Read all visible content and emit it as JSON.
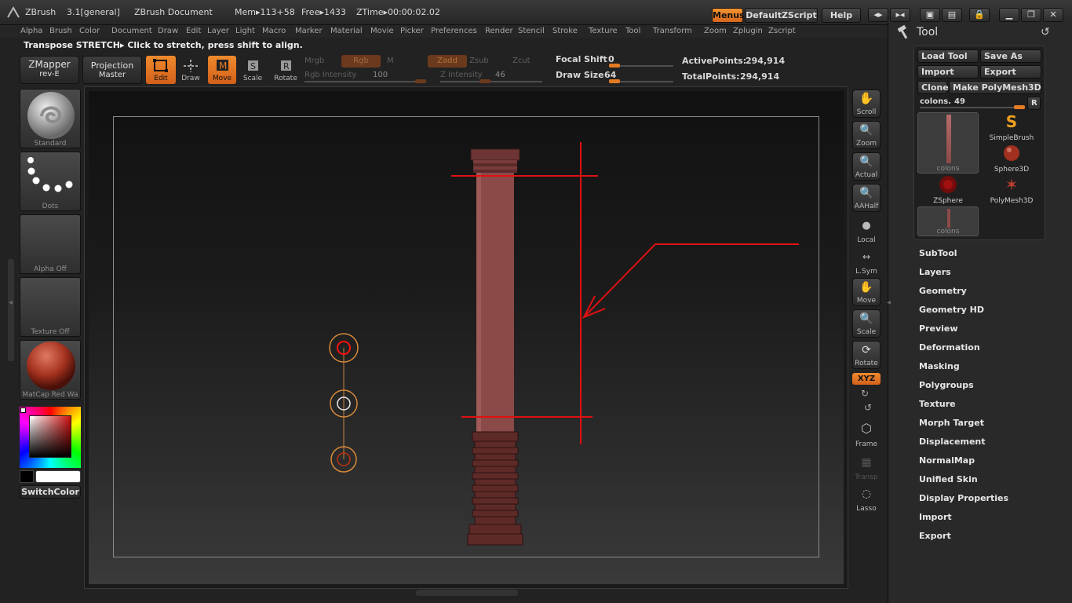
{
  "titlebar": {
    "app": "ZBrush",
    "version": "3.1[general]",
    "document": "ZBrush Document",
    "mem": "Mem▸113+58",
    "free": "Free▸1433",
    "ztime": "ZTime▸00:00:02.02",
    "menus_label": "Menus",
    "zscript_label": "DefaultZScript",
    "help_label": "Help"
  },
  "menu": [
    "Alpha",
    "Brush",
    "Color",
    "Document",
    "Draw",
    "Edit",
    "Layer",
    "Light",
    "Macro",
    "Marker",
    "Material",
    "Movie",
    "Picker",
    "Preferences",
    "Render",
    "Stencil",
    "Stroke",
    "Texture",
    "Tool",
    "Transform",
    "Zoom",
    "Zplugin",
    "Zscript"
  ],
  "status": "Transpose STRETCH▸ Click to stretch, press shift to align.",
  "shelf": {
    "zmapper": "ZMapper",
    "zmapper_sub": "rev-E",
    "projection": "Projection",
    "projection_sub": "Master",
    "edit": "Edit",
    "draw": "Draw",
    "move": "Move",
    "scale": "Scale",
    "rotate": "Rotate",
    "mrgb": "Mrgb",
    "rgb": "Rgb",
    "m": "M",
    "zadd": "Zadd",
    "zsub": "Zsub",
    "zcut": "Zcut",
    "rgb_intensity_label": "Rgb Intensity",
    "rgb_intensity": "100",
    "z_intensity_label": "Z Intensity",
    "z_intensity": "46",
    "focal_shift_label": "Focal Shift",
    "focal_shift": "0",
    "draw_size_label": "Draw Size",
    "draw_size": "64",
    "active_points_label": "ActivePoints:",
    "active_points": "294,914",
    "total_points_label": "TotalPoints:",
    "total_points": "294,914"
  },
  "left": {
    "brush": "Standard",
    "stroke": "Dots",
    "alpha": "Alpha Off",
    "texture": "Texture Off",
    "material": "MatCap Red Wa",
    "switch_color": "SwitchColor"
  },
  "right_shelf": {
    "scroll": "Scroll",
    "zoom": "Zoom",
    "actual": "Actual",
    "aahalf": "AAHalf",
    "local": "Local",
    "lsym": "L.Sym",
    "move": "Move",
    "scale": "Scale",
    "rotate": "Rotate",
    "xyz": "XYZ",
    "frame": "Frame",
    "transp": "Transp",
    "lasso": "Lasso"
  },
  "tool": {
    "title": "Tool",
    "load": "Load Tool",
    "save": "Save As",
    "import": "Import",
    "export": "Export",
    "clone": "Clone",
    "make_poly": "Make PolyMesh3D",
    "slider_label": "colons.",
    "slider_value": "49",
    "r_btn": "R",
    "tiles": [
      "colons",
      "SimpleBrush",
      "Sphere3D",
      "ZSphere",
      "PolyMesh3D",
      "colons"
    ],
    "sections": [
      "SubTool",
      "Layers",
      "Geometry",
      "Geometry HD",
      "Preview",
      "Deformation",
      "Masking",
      "Polygroups",
      "Texture",
      "Morph Target",
      "Displacement",
      "NormalMap",
      "Unified Skin",
      "Display Properties",
      "Import",
      "Export"
    ]
  },
  "colors": {
    "accent_orange": "#e57b23",
    "column_fill": "#8a4a48",
    "marker_red": "#e01010"
  }
}
